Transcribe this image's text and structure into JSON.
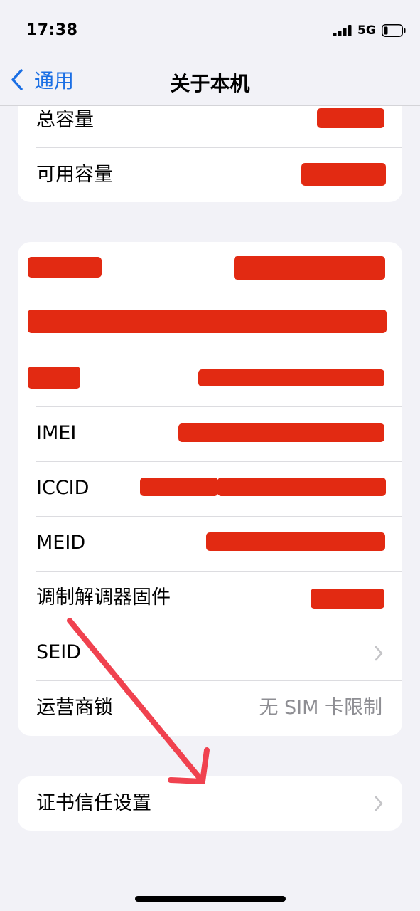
{
  "status_bar": {
    "time": "17:38",
    "network": "5G"
  },
  "nav": {
    "back_label": "通用",
    "title": "关于本机"
  },
  "storage": {
    "items": [
      {
        "label": "总容量",
        "value_redacted": true
      },
      {
        "label": "可用容量",
        "value_redacted": true
      }
    ]
  },
  "info": {
    "items": [
      {
        "label": "",
        "value_redacted": true
      },
      {
        "label": "",
        "value_redacted": true
      },
      {
        "label": "",
        "value_redacted": true
      },
      {
        "label": "IMEI",
        "value_redacted": true
      },
      {
        "label": "ICCID",
        "value_redacted": true
      },
      {
        "label": "MEID",
        "value_redacted": true
      },
      {
        "label": "调制解调器固件",
        "value_redacted": true
      },
      {
        "label": "SEID",
        "chevron": true
      },
      {
        "label": "运营商锁",
        "value": "无 SIM 卡限制"
      }
    ]
  },
  "certificate": {
    "label": "证书信任设置",
    "chevron": true
  },
  "colors": {
    "accent": "#1b6fe4",
    "redaction": "#e22a12",
    "annotation_arrow": "#f0424f",
    "background": "#f2f2f7"
  }
}
